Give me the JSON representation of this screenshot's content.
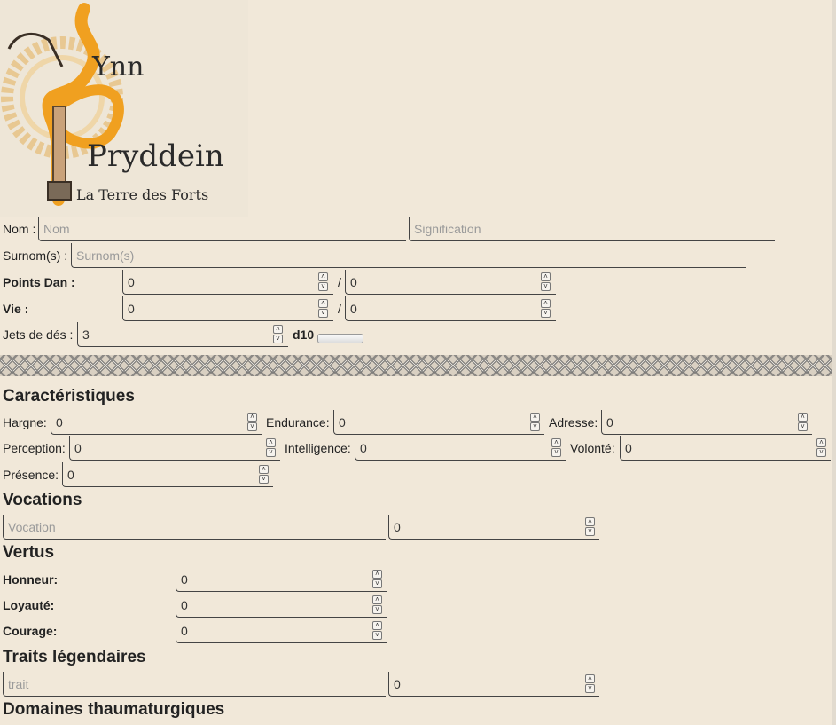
{
  "logo": {
    "line1": "Ynn",
    "line2": "Pryddein",
    "tagline": "La Terre des Forts"
  },
  "identity": {
    "nom_label": "Nom :",
    "nom_placeholder": "Nom",
    "signification_placeholder": "Signification",
    "surnom_label": "Surnom(s) :",
    "surnom_placeholder": "Surnom(s)",
    "points_dan_label": "Points Dan :",
    "points_dan_value": "0",
    "points_dan_max": "0",
    "vie_label": "Vie :",
    "vie_value": "0",
    "vie_max": "0",
    "slash": "/",
    "jets_label": "Jets de dés :",
    "jets_value": "3",
    "dice_label": "d10"
  },
  "caracteristiques": {
    "title": "Caractéristiques",
    "items": [
      {
        "label": "Hargne:",
        "value": "0"
      },
      {
        "label": "Endurance:",
        "value": "0"
      },
      {
        "label": "Adresse:",
        "value": "0"
      },
      {
        "label": "Perception:",
        "value": "0"
      },
      {
        "label": "Intelligence:",
        "value": "0"
      },
      {
        "label": "Volonté:",
        "value": "0"
      },
      {
        "label": "Présence:",
        "value": "0"
      }
    ]
  },
  "vocations": {
    "title": "Vocations",
    "name_placeholder": "Vocation",
    "value": "0"
  },
  "vertus": {
    "title": "Vertus",
    "items": [
      {
        "label": "Honneur:",
        "value": "0"
      },
      {
        "label": "Loyauté:",
        "value": "0"
      },
      {
        "label": "Courage:",
        "value": "0"
      }
    ]
  },
  "traits": {
    "title": "Traits légendaires",
    "name_placeholder": "trait",
    "value": "0"
  },
  "domaines": {
    "title": "Domaines thaumaturgiques"
  },
  "colors": {
    "background": "#f1e8d9",
    "logo_orange": "#f0a020",
    "text": "#222222"
  }
}
